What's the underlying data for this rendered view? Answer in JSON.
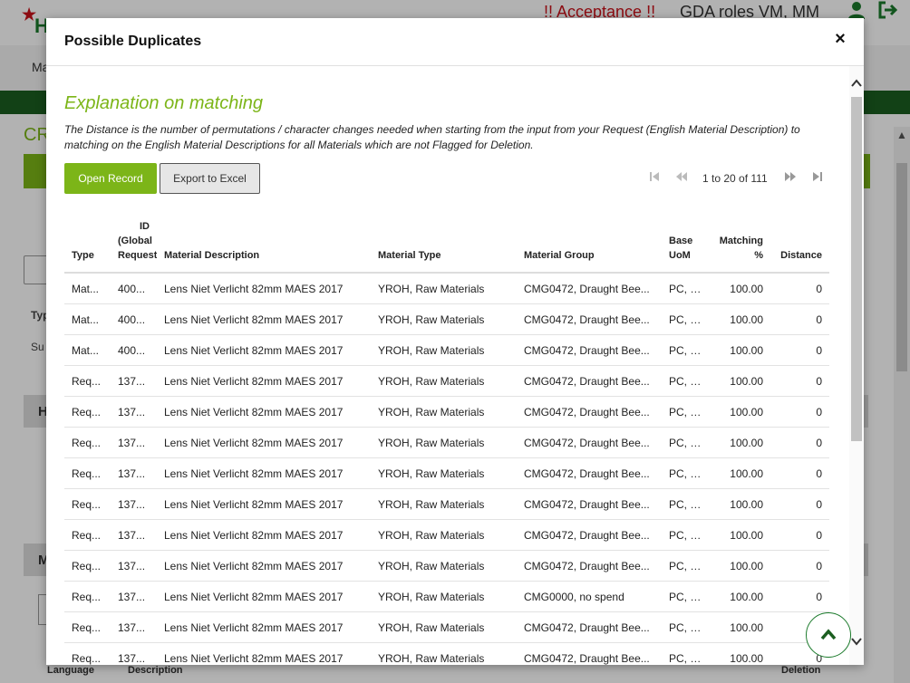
{
  "background": {
    "acceptance_text": "!! Acceptance !!",
    "roles_text": "GDA roles VM, MM",
    "logo_letter": "H",
    "nav_label": "Ma",
    "cr_label": "CR",
    "col_type_short": "Typ",
    "row_short": "Su",
    "panel_h_label": "H",
    "panel_m_label": "M",
    "bottom_headers": {
      "language": "Language",
      "description": "Description",
      "deletion": "Deletion"
    }
  },
  "modal": {
    "title": "Possible Duplicates",
    "close_label": "×",
    "explanation_title": "Explanation on matching",
    "explanation_text": "The Distance is the number of permutations / character changes needed when starting from the input from your Request (English Material Description) to matching on the English Material Descriptions for all Materials which are not Flagged for Deletion.",
    "buttons": {
      "open_record": "Open Record",
      "export_excel": "Export to Excel"
    },
    "pager": {
      "text": "1 to 20 of 111"
    },
    "columns": [
      {
        "key": "type",
        "label": "Type"
      },
      {
        "key": "id",
        "label": "ID (Global Request"
      },
      {
        "key": "desc",
        "label": "Material Description"
      },
      {
        "key": "mtype",
        "label": "Material Type"
      },
      {
        "key": "mgroup",
        "label": "Material Group"
      },
      {
        "key": "uom",
        "label": "Base UoM"
      },
      {
        "key": "match",
        "label": "Matching %"
      },
      {
        "key": "distance",
        "label": "Distance"
      }
    ],
    "rows": [
      [
        "Mat...",
        "400...",
        "Lens Niet Verlicht 82mm MAES 2017",
        "YROH, Raw Materials",
        "CMG0472, Draught Bee...",
        "PC, p...",
        "100.00",
        "0"
      ],
      [
        "Mat...",
        "400...",
        "Lens Niet Verlicht 82mm MAES 2017",
        "YROH, Raw Materials",
        "CMG0472, Draught Bee...",
        "PC, p...",
        "100.00",
        "0"
      ],
      [
        "Mat...",
        "400...",
        "Lens Niet Verlicht 82mm MAES 2017",
        "YROH, Raw Materials",
        "CMG0472, Draught Bee...",
        "PC, p...",
        "100.00",
        "0"
      ],
      [
        "Req...",
        "137...",
        "Lens Niet Verlicht 82mm MAES 2017",
        "YROH, Raw Materials",
        "CMG0472, Draught Bee...",
        "PC, p...",
        "100.00",
        "0"
      ],
      [
        "Req...",
        "137...",
        "Lens Niet Verlicht 82mm MAES 2017",
        "YROH, Raw Materials",
        "CMG0472, Draught Bee...",
        "PC, p...",
        "100.00",
        "0"
      ],
      [
        "Req...",
        "137...",
        "Lens Niet Verlicht 82mm MAES 2017",
        "YROH, Raw Materials",
        "CMG0472, Draught Bee...",
        "PC, p...",
        "100.00",
        "0"
      ],
      [
        "Req...",
        "137...",
        "Lens Niet Verlicht 82mm MAES 2017",
        "YROH, Raw Materials",
        "CMG0472, Draught Bee...",
        "PC, p...",
        "100.00",
        "0"
      ],
      [
        "Req...",
        "137...",
        "Lens Niet Verlicht 82mm MAES 2017",
        "YROH, Raw Materials",
        "CMG0472, Draught Bee...",
        "PC, p...",
        "100.00",
        "0"
      ],
      [
        "Req...",
        "137...",
        "Lens Niet Verlicht 82mm MAES 2017",
        "YROH, Raw Materials",
        "CMG0472, Draught Bee...",
        "PC, p...",
        "100.00",
        "0"
      ],
      [
        "Req...",
        "137...",
        "Lens Niet Verlicht 82mm MAES 2017",
        "YROH, Raw Materials",
        "CMG0472, Draught Bee...",
        "PC, p...",
        "100.00",
        "0"
      ],
      [
        "Req...",
        "137...",
        "Lens Niet Verlicht 82mm MAES 2017",
        "YROH, Raw Materials",
        "CMG0000, no spend",
        "PC, p...",
        "100.00",
        "0"
      ],
      [
        "Req...",
        "137...",
        "Lens Niet Verlicht 82mm MAES 2017",
        "YROH, Raw Materials",
        "CMG0472, Draught Bee...",
        "PC, p...",
        "100.00",
        "0"
      ],
      [
        "Req...",
        "137...",
        "Lens Niet Verlicht 82mm MAES 2017",
        "YROH, Raw Materials",
        "CMG0472, Draught Bee...",
        "PC, p...",
        "100.00",
        "0"
      ]
    ]
  },
  "icons": {
    "user": "user-icon",
    "logout": "logout-icon",
    "close": "close-icon",
    "pager_first": "first-page-icon",
    "pager_prev": "prev-page-icon",
    "pager_next": "next-page-icon",
    "pager_last": "last-page-icon",
    "scroll_top": "chevron-up-icon"
  },
  "colors": {
    "brand_green": "#7cb518",
    "dark_green": "#1b5e20",
    "acceptance_red": "#c9121a"
  }
}
